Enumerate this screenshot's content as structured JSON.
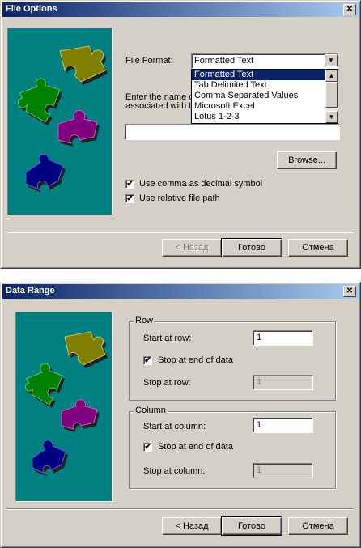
{
  "dialog1": {
    "title": "File Options",
    "file_format_label": "File Format:",
    "file_format_value": "Formatted Text",
    "file_format_options": [
      "Formatted Text",
      "Tab Delimited Text",
      "Comma Separated Values",
      "Microsoft Excel",
      "Lotus 1-2-3"
    ],
    "enter_name_line1": "Enter the name o",
    "enter_name_line2": "associated with t",
    "filename_value": "",
    "browse_label": "Browse...",
    "use_comma_label": "Use comma as decimal symbol",
    "use_comma_checked": true,
    "use_relative_label": "Use relative file path",
    "use_relative_checked": true,
    "back_label": "< Назад",
    "done_label": "Готово",
    "cancel_label": "Отмена"
  },
  "dialog2": {
    "title": "Data Range",
    "row_group": "Row",
    "start_row_label": "Start at row:",
    "start_row_value": "1",
    "stop_end_label": "Stop at end of data",
    "stop_end_checked": true,
    "stop_row_label": "Stop at row:",
    "stop_row_value": "1",
    "column_group": "Column",
    "start_col_label": "Start at column:",
    "start_col_value": "1",
    "stop_end_col_label": "Stop at end of data",
    "stop_end_col_checked": true,
    "stop_col_label": "Stop at column:",
    "stop_col_value": "1",
    "back_label": "< Назад",
    "done_label": "Готово",
    "cancel_label": "Отмена"
  },
  "colors": {
    "titlebar_start": "#0a246a",
    "titlebar_end": "#a6caf0",
    "dialog_face": "#d4d0c8",
    "wizard_panel": "#008080",
    "piece_olive": "#808000",
    "piece_green": "#008000",
    "piece_purple": "#800080",
    "piece_navy": "#000080"
  }
}
